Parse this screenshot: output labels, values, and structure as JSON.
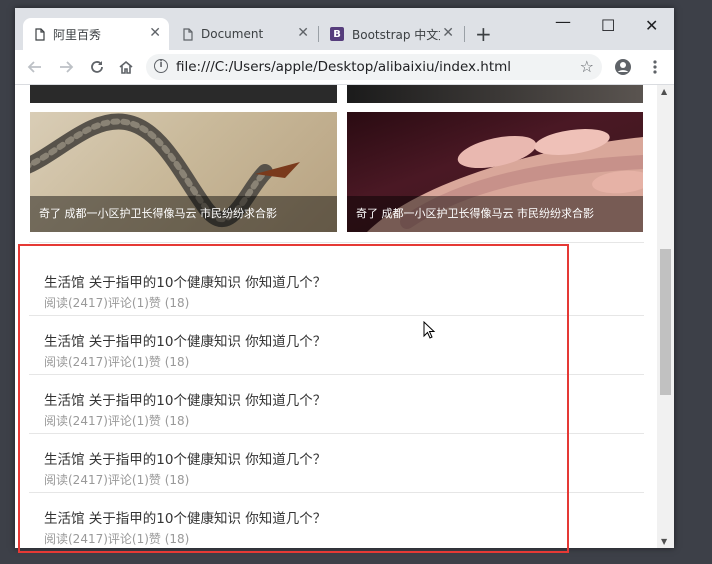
{
  "browser": {
    "tabs": [
      {
        "title": "阿里百秀",
        "close": "✕",
        "active": true
      },
      {
        "title": "Document",
        "close": "✕",
        "active": false
      },
      {
        "title": "Bootstrap 中文文",
        "close": "✕",
        "active": false,
        "icon_letter": "B"
      }
    ],
    "new_tab": "+",
    "window_controls": {
      "minimize": "—",
      "maximize": "☐",
      "close": "✕"
    },
    "url": "file:///C:/Users/apple/Desktop/alibaixiu/index.html"
  },
  "page": {
    "image_cards": [
      {
        "caption": "奇了 成都一小区护卫长得像马云 市民纷纷求合影",
        "image": "snake-photo"
      },
      {
        "caption": "奇了 成都一小区护卫长得像马云 市民纷纷求合影",
        "image": "fingernails-photo"
      }
    ],
    "news": [
      {
        "title": "生活馆 关于指甲的10个健康知识 你知道几个？",
        "meta": "阅读(2417)评论(1)赞 (18)"
      },
      {
        "title": "生活馆 关于指甲的10个健康知识 你知道几个？",
        "meta": "阅读(2417)评论(1)赞 (18)"
      },
      {
        "title": "生活馆 关于指甲的10个健康知识 你知道几个？",
        "meta": "阅读(2417)评论(1)赞 (18)"
      },
      {
        "title": "生活馆 关于指甲的10个健康知识 你知道几个？",
        "meta": "阅读(2417)评论(1)赞 (18)"
      },
      {
        "title": "生活馆 关于指甲的10个健康知识 你知道几个？",
        "meta": "阅读(2417)评论(1)赞 (18)"
      }
    ]
  },
  "colors": {
    "highlight": "#e53935",
    "desktop": "#3d4048",
    "meta_text": "#999999"
  }
}
